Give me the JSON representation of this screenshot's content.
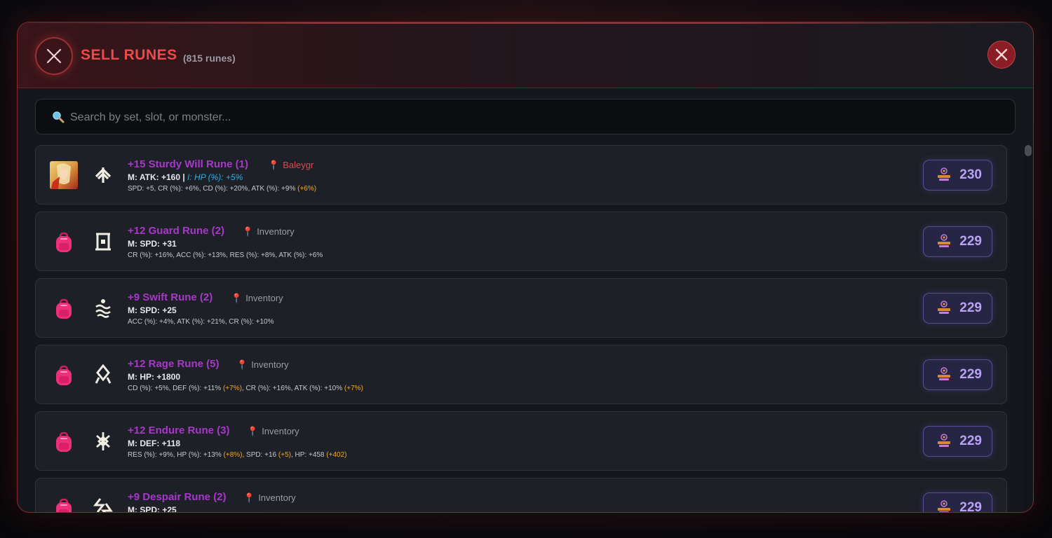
{
  "header": {
    "title": "SELL RUNES",
    "count": "(815 runes)"
  },
  "search": {
    "placeholder": "Search by set, slot, or monster..."
  },
  "runes": [
    {
      "title": "+15 Sturdy Will Rune (1)",
      "location": "Baleygr",
      "location_type": "monster",
      "icon": "will-rune-icon",
      "main": "M: ATK: +160",
      "innate": "I: HP (%): +5%",
      "subs": [
        {
          "text": "SPD: +5, "
        },
        {
          "text": "CR (%): +6%, "
        },
        {
          "text": "CD (%): +20%, "
        },
        {
          "text": "ATK (%): +9% "
        },
        {
          "text": "(+6%)",
          "grind": true
        }
      ],
      "price": "230"
    },
    {
      "title": "+12 Guard Rune (2)",
      "location": "Inventory",
      "location_type": "inventory",
      "icon": "guard-rune-icon",
      "main": "M: SPD: +31",
      "innate": "",
      "subs": [
        {
          "text": "CR (%): +16%, ACC (%): +13%, RES (%): +8%, ATK (%): +6%"
        }
      ],
      "price": "229"
    },
    {
      "title": "+9 Swift Rune (2)",
      "location": "Inventory",
      "location_type": "inventory",
      "icon": "swift-rune-icon",
      "main": "M: SPD: +25",
      "innate": "",
      "subs": [
        {
          "text": "ACC (%): +4%, ATK (%): +21%, CR (%): +10%"
        }
      ],
      "price": "229"
    },
    {
      "title": "+12 Rage Rune (5)",
      "location": "Inventory",
      "location_type": "inventory",
      "icon": "rage-rune-icon",
      "main": "M: HP: +1800",
      "innate": "",
      "subs": [
        {
          "text": "CD (%): +5%, DEF (%): +11% "
        },
        {
          "text": "(+7%)",
          "grind": true
        },
        {
          "text": ", CR (%): +16%, ATK (%): +10% "
        },
        {
          "text": "(+7%)",
          "grind": true
        }
      ],
      "price": "229"
    },
    {
      "title": "+12 Endure Rune (3)",
      "location": "Inventory",
      "location_type": "inventory",
      "icon": "endure-rune-icon",
      "main": "M: DEF: +118",
      "innate": "",
      "subs": [
        {
          "text": "RES (%): +9%, HP (%): +13% "
        },
        {
          "text": "(+8%)",
          "grind": true
        },
        {
          "text": ", SPD: +16 "
        },
        {
          "text": "(+5)",
          "grind": true
        },
        {
          "text": ", HP: +458 "
        },
        {
          "text": "(+402)",
          "grind": true
        }
      ],
      "price": "229"
    },
    {
      "title": "+9 Despair Rune (2)",
      "location": "Inventory",
      "location_type": "inventory",
      "icon": "despair-rune-icon",
      "main": "M: SPD: +25",
      "innate": "",
      "subs": [],
      "price": "229"
    }
  ],
  "colors": {
    "accent_red": "#ec4a4a",
    "rune_title": "#a838c9",
    "grind": "#f0a820",
    "innate": "#2bb0e6",
    "price": "#b9a2f4"
  }
}
